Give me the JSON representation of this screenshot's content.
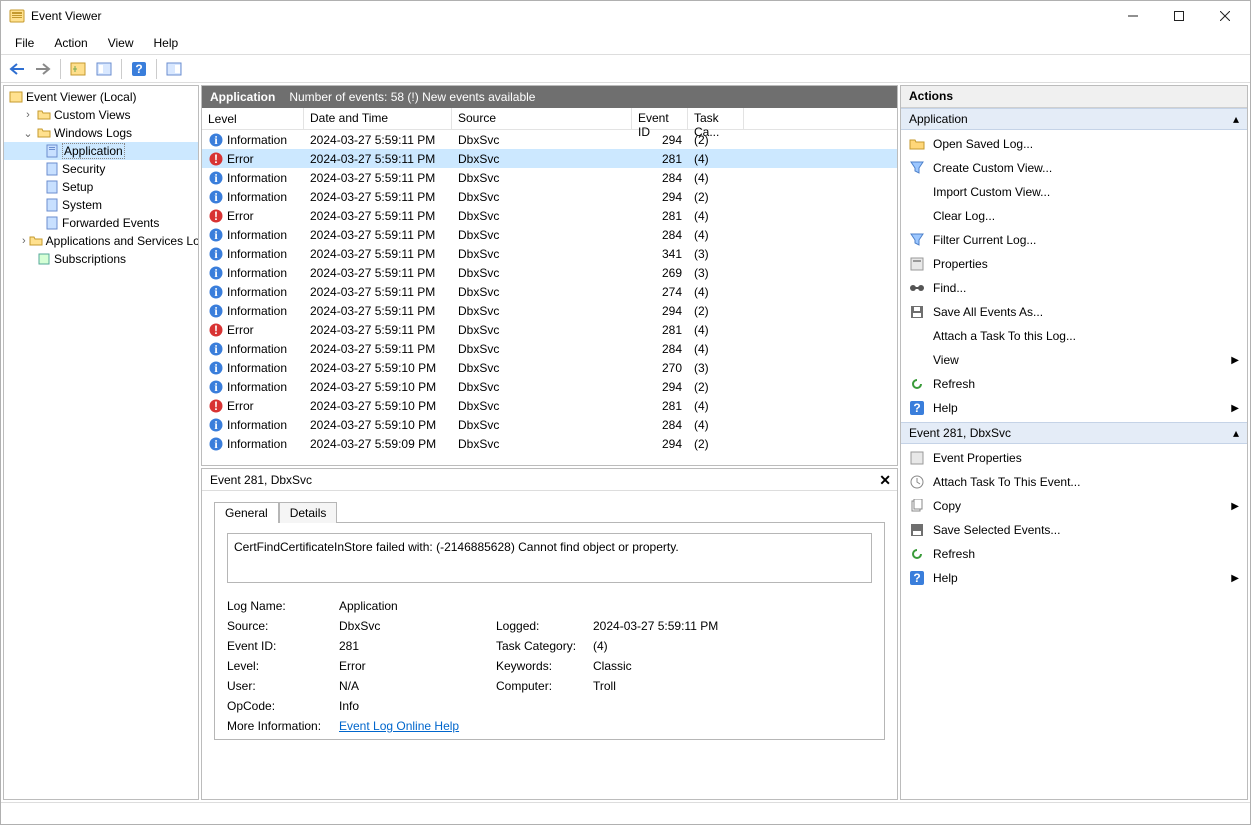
{
  "window": {
    "title": "Event Viewer"
  },
  "menu": {
    "file": "File",
    "action": "Action",
    "view": "View",
    "help": "Help"
  },
  "nav": {
    "root": "Event Viewer (Local)",
    "custom_views": "Custom Views",
    "windows_logs": "Windows Logs",
    "application": "Application",
    "security": "Security",
    "setup": "Setup",
    "system": "System",
    "forwarded": "Forwarded Events",
    "apps_services": "Applications and Services Lo",
    "subscriptions": "Subscriptions"
  },
  "listheader": {
    "title": "Application",
    "status": "Number of events: 58  (!) New events available"
  },
  "columns": {
    "level": "Level",
    "datetime": "Date and Time",
    "source": "Source",
    "eventid": "Event ID",
    "task": "Task Ca..."
  },
  "events": [
    {
      "level": "Information",
      "kind": "info",
      "dt": "2024-03-27 5:59:11 PM",
      "src": "DbxSvc",
      "id": "294",
      "task": "(2)"
    },
    {
      "level": "Error",
      "kind": "error",
      "dt": "2024-03-27 5:59:11 PM",
      "src": "DbxSvc",
      "id": "281",
      "task": "(4)",
      "selected": true
    },
    {
      "level": "Information",
      "kind": "info",
      "dt": "2024-03-27 5:59:11 PM",
      "src": "DbxSvc",
      "id": "284",
      "task": "(4)"
    },
    {
      "level": "Information",
      "kind": "info",
      "dt": "2024-03-27 5:59:11 PM",
      "src": "DbxSvc",
      "id": "294",
      "task": "(2)"
    },
    {
      "level": "Error",
      "kind": "error",
      "dt": "2024-03-27 5:59:11 PM",
      "src": "DbxSvc",
      "id": "281",
      "task": "(4)"
    },
    {
      "level": "Information",
      "kind": "info",
      "dt": "2024-03-27 5:59:11 PM",
      "src": "DbxSvc",
      "id": "284",
      "task": "(4)"
    },
    {
      "level": "Information",
      "kind": "info",
      "dt": "2024-03-27 5:59:11 PM",
      "src": "DbxSvc",
      "id": "341",
      "task": "(3)"
    },
    {
      "level": "Information",
      "kind": "info",
      "dt": "2024-03-27 5:59:11 PM",
      "src": "DbxSvc",
      "id": "269",
      "task": "(3)"
    },
    {
      "level": "Information",
      "kind": "info",
      "dt": "2024-03-27 5:59:11 PM",
      "src": "DbxSvc",
      "id": "274",
      "task": "(4)"
    },
    {
      "level": "Information",
      "kind": "info",
      "dt": "2024-03-27 5:59:11 PM",
      "src": "DbxSvc",
      "id": "294",
      "task": "(2)"
    },
    {
      "level": "Error",
      "kind": "error",
      "dt": "2024-03-27 5:59:11 PM",
      "src": "DbxSvc",
      "id": "281",
      "task": "(4)"
    },
    {
      "level": "Information",
      "kind": "info",
      "dt": "2024-03-27 5:59:11 PM",
      "src": "DbxSvc",
      "id": "284",
      "task": "(4)"
    },
    {
      "level": "Information",
      "kind": "info",
      "dt": "2024-03-27 5:59:10 PM",
      "src": "DbxSvc",
      "id": "270",
      "task": "(3)"
    },
    {
      "level": "Information",
      "kind": "info",
      "dt": "2024-03-27 5:59:10 PM",
      "src": "DbxSvc",
      "id": "294",
      "task": "(2)"
    },
    {
      "level": "Error",
      "kind": "error",
      "dt": "2024-03-27 5:59:10 PM",
      "src": "DbxSvc",
      "id": "281",
      "task": "(4)"
    },
    {
      "level": "Information",
      "kind": "info",
      "dt": "2024-03-27 5:59:10 PM",
      "src": "DbxSvc",
      "id": "284",
      "task": "(4)"
    },
    {
      "level": "Information",
      "kind": "info",
      "dt": "2024-03-27 5:59:09 PM",
      "src": "DbxSvc",
      "id": "294",
      "task": "(2)"
    }
  ],
  "detail": {
    "title": "Event 281, DbxSvc",
    "tabs": {
      "general": "General",
      "details": "Details"
    },
    "message": "CertFindCertificateInStore failed with: (-2146885628) Cannot find object or property.",
    "labels": {
      "log_name": "Log Name:",
      "source": "Source:",
      "event_id": "Event ID:",
      "level": "Level:",
      "user": "User:",
      "opcode": "OpCode:",
      "more_info": "More Information:",
      "logged": "Logged:",
      "task_cat": "Task Category:",
      "keywords": "Keywords:",
      "computer": "Computer:"
    },
    "values": {
      "log_name": "Application",
      "source": "DbxSvc",
      "event_id": "281",
      "level": "Error",
      "user": "N/A",
      "opcode": "Info",
      "more_info_link": "Event Log Online Help",
      "logged": "2024-03-27 5:59:11 PM",
      "task_cat": "(4)",
      "keywords": "Classic",
      "computer": "Troll"
    }
  },
  "actions": {
    "title": "Actions",
    "section_app": "Application",
    "section_evt": "Event 281, DbxSvc",
    "app": {
      "open_saved": "Open Saved Log...",
      "create_custom": "Create Custom View...",
      "import_custom": "Import Custom View...",
      "clear_log": "Clear Log...",
      "filter_log": "Filter Current Log...",
      "properties": "Properties",
      "find": "Find...",
      "save_all": "Save All Events As...",
      "attach_task": "Attach a Task To this Log...",
      "view": "View",
      "refresh": "Refresh",
      "help": "Help"
    },
    "evt": {
      "event_props": "Event Properties",
      "attach_task": "Attach Task To This Event...",
      "copy": "Copy",
      "save_selected": "Save Selected Events...",
      "refresh": "Refresh",
      "help": "Help"
    }
  }
}
